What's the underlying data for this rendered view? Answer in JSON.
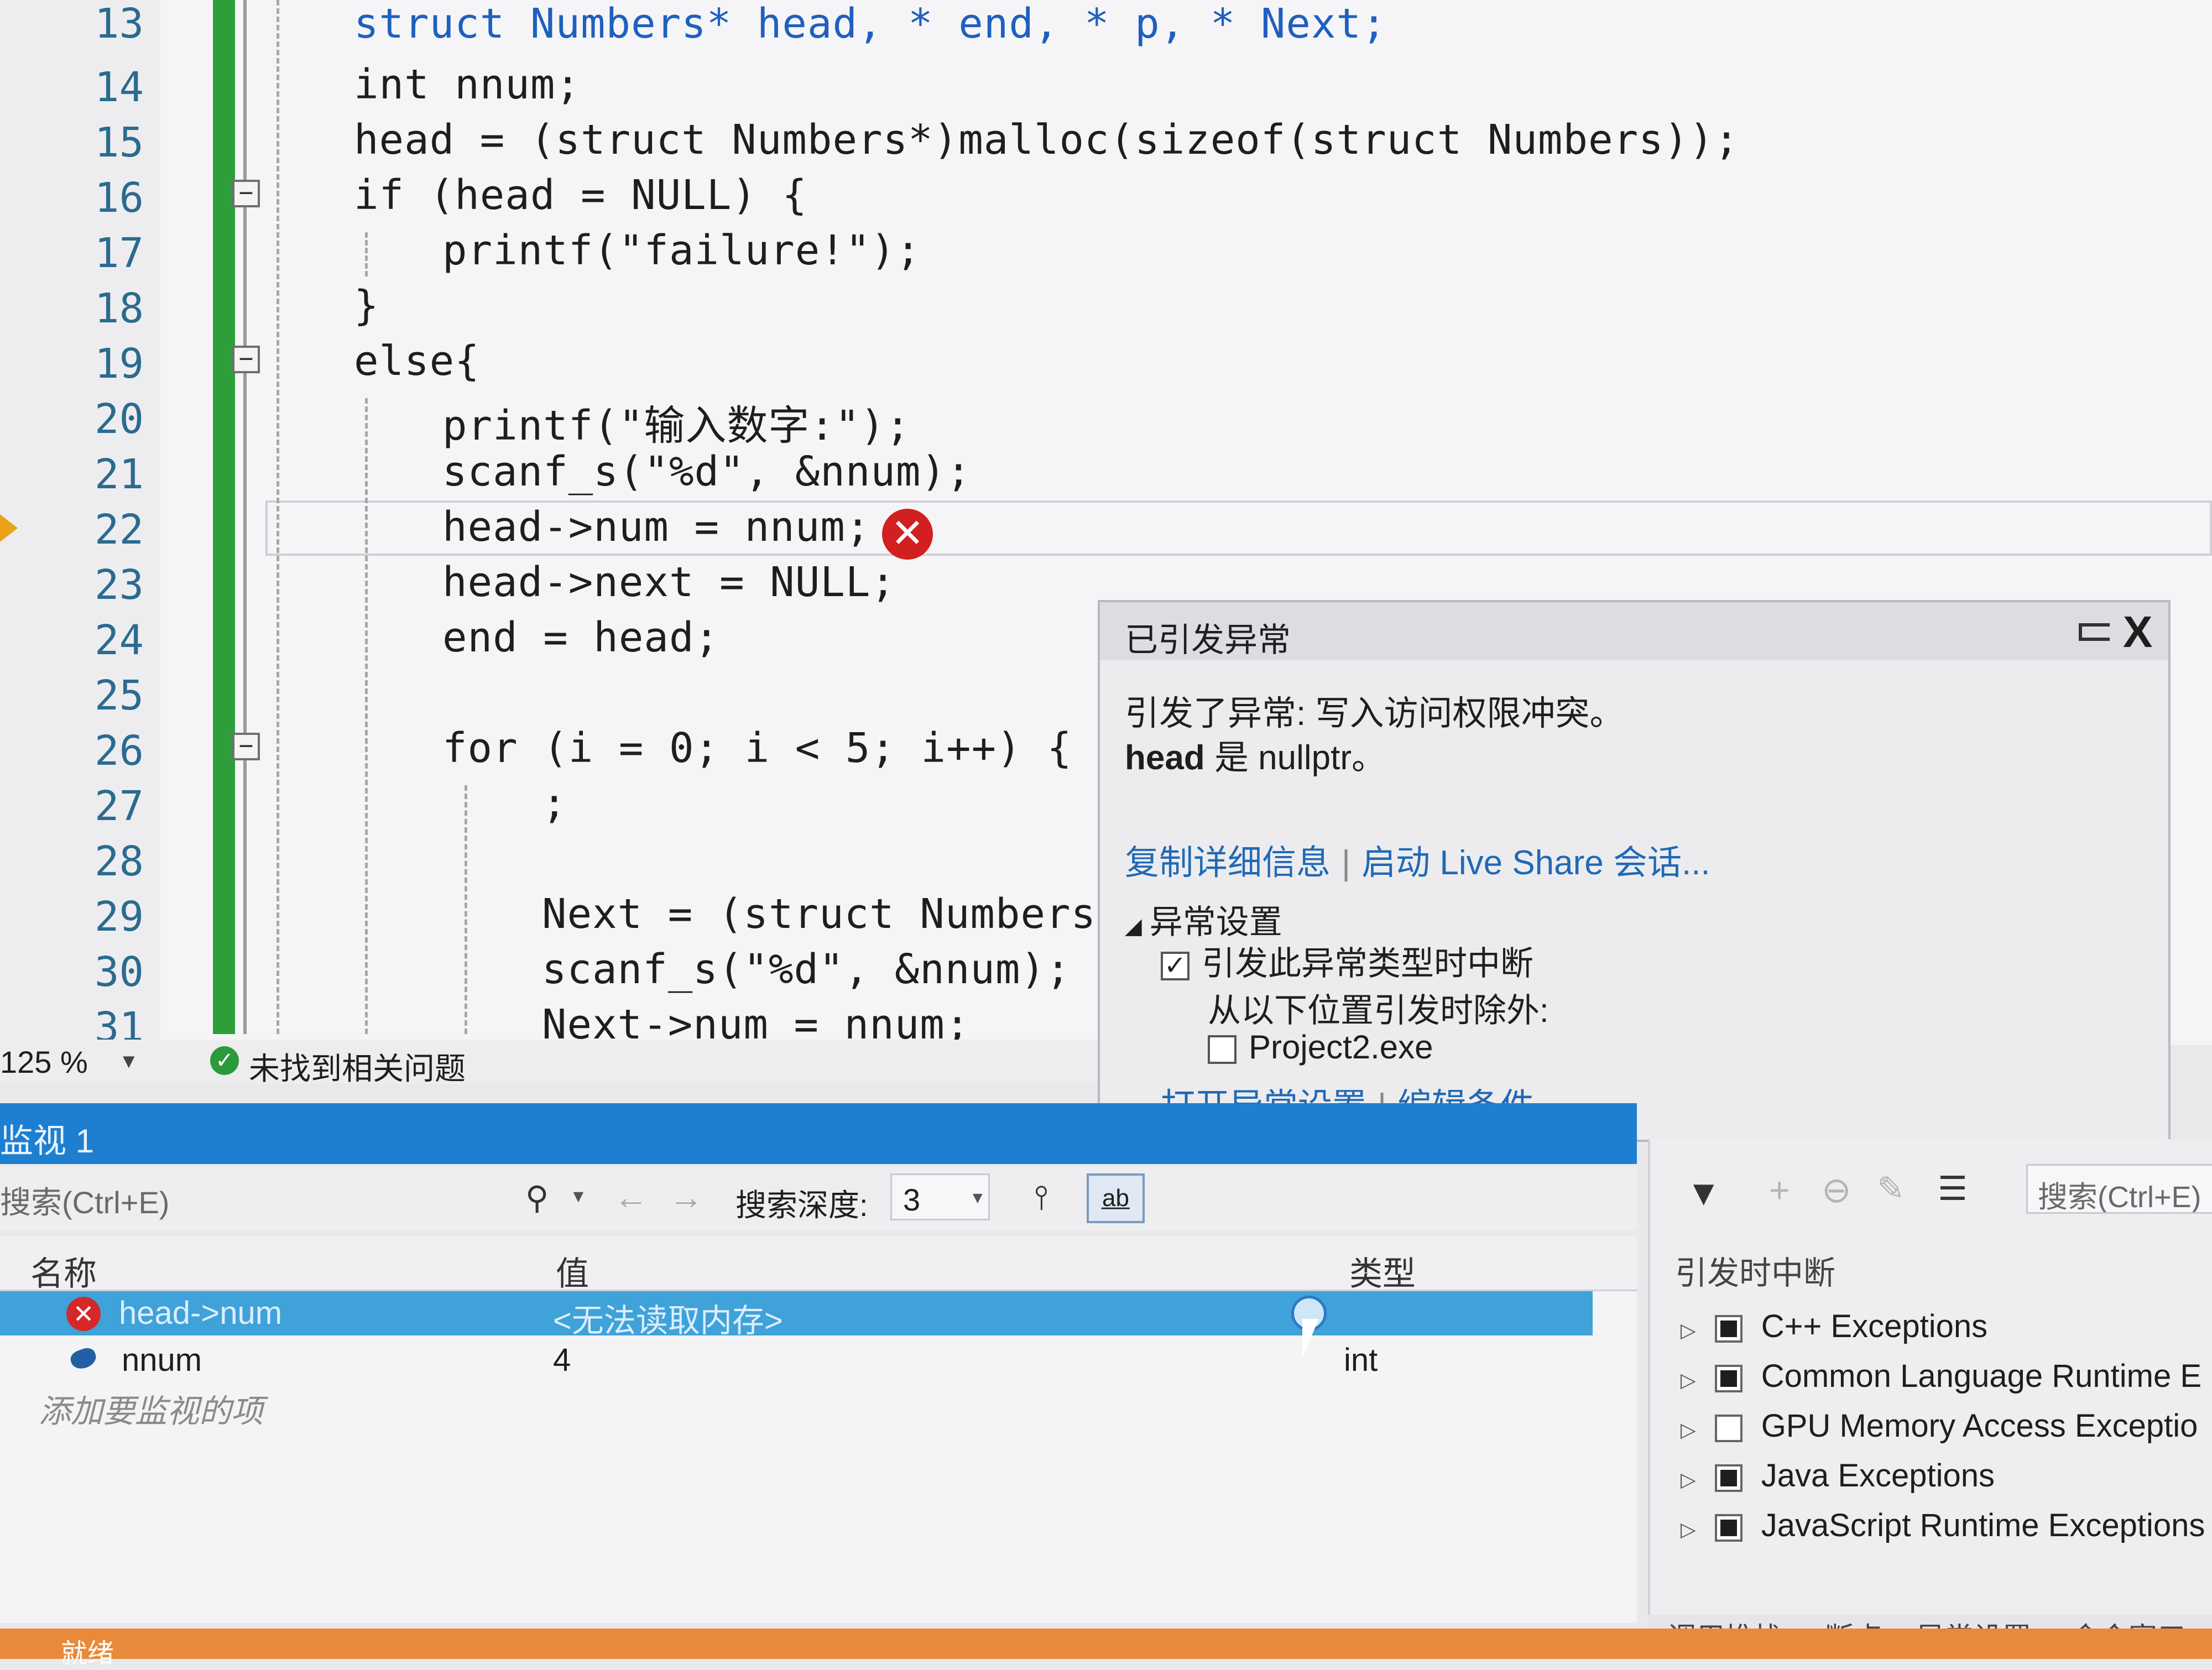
{
  "editor": {
    "line_numbers": [
      "13",
      "14",
      "15",
      "16",
      "17",
      "18",
      "19",
      "20",
      "21",
      "22",
      "23",
      "24",
      "25",
      "26",
      "27",
      "28",
      "29",
      "30",
      "31"
    ],
    "lines": {
      "l13": "struct Numbers* head, * end, * p, * Next;",
      "l14": "int nnum;",
      "l15": "head = (struct Numbers*)malloc(sizeof(struct Numbers));",
      "l16": "if (head = NULL) {",
      "l17": "printf(\"failure!\");",
      "l18": "}",
      "l19": "else{",
      "l20": "printf(\"输入数字:\");",
      "l21": "scanf_s(\"%d\", &nnum);",
      "l22": "head->num = nnum;",
      "l23": "head->next = NULL;",
      "l24": "end = head;",
      "l26": "for (i = 0; i < 5; i++) {",
      "l27": ";",
      "l29": "Next = (struct Numbers*)m",
      "l30": "scanf_s(\"%d\", &nnum);",
      "l31": "Next->num = nnum;"
    },
    "fold_symbol": "−",
    "error_glyph": "✕"
  },
  "editor_status": {
    "zoom": "125 %",
    "issues_icon": "check-circle-icon",
    "issues_text": "未找到相关问题"
  },
  "exception_popup": {
    "title": "已引发异常",
    "close": "X",
    "message": "引发了异常: 写入访问权限冲突。",
    "detail_var": "head",
    "detail_rest": " 是 nullptr。",
    "link_copy": "复制详细信息",
    "link_liveshare": "启动 Live Share 会话...",
    "settings_heading": "异常设置",
    "break_label": "引发此异常类型时中断",
    "except_label": "从以下位置引发时除外:",
    "project_label": "Project2.exe",
    "link_open_settings": "打开异常设置",
    "link_edit_conditions": "编辑条件",
    "break_checked": true,
    "project_checked": false
  },
  "watch": {
    "title": "监视 1",
    "search_placeholder": "搜索(Ctrl+E)",
    "depth_label": "搜索深度:",
    "depth_value": "3",
    "hex_label": "a̲b̲",
    "columns": {
      "name": "名称",
      "value": "值",
      "type": "类型"
    },
    "rows": [
      {
        "name": "head->num",
        "value": "<无法读取内存>",
        "type": "",
        "status": "error"
      },
      {
        "name": "nnum",
        "value": "4",
        "type": "int",
        "status": "ok"
      }
    ],
    "add_item": "添加要监视的项"
  },
  "exception_settings": {
    "search_placeholder": "搜索(Ctrl+E)",
    "heading": "引发时中断",
    "items": [
      {
        "label": "C++ Exceptions",
        "checked": true
      },
      {
        "label": "Common Language Runtime E",
        "checked": true
      },
      {
        "label": "GPU Memory Access Exceptio",
        "checked": false
      },
      {
        "label": "Java Exceptions",
        "checked": true
      },
      {
        "label": "JavaScript Runtime Exceptions",
        "checked": true
      }
    ]
  },
  "bottom_tabs": [
    "调用堆栈",
    "断点",
    "异常设置",
    "命令窗口"
  ],
  "status_bar": {
    "text": "就绪"
  },
  "colors": {
    "accent": "#1e7fd0",
    "error": "#d21f1f",
    "changed": "#2e9e3b",
    "status": "#e88a3a"
  }
}
